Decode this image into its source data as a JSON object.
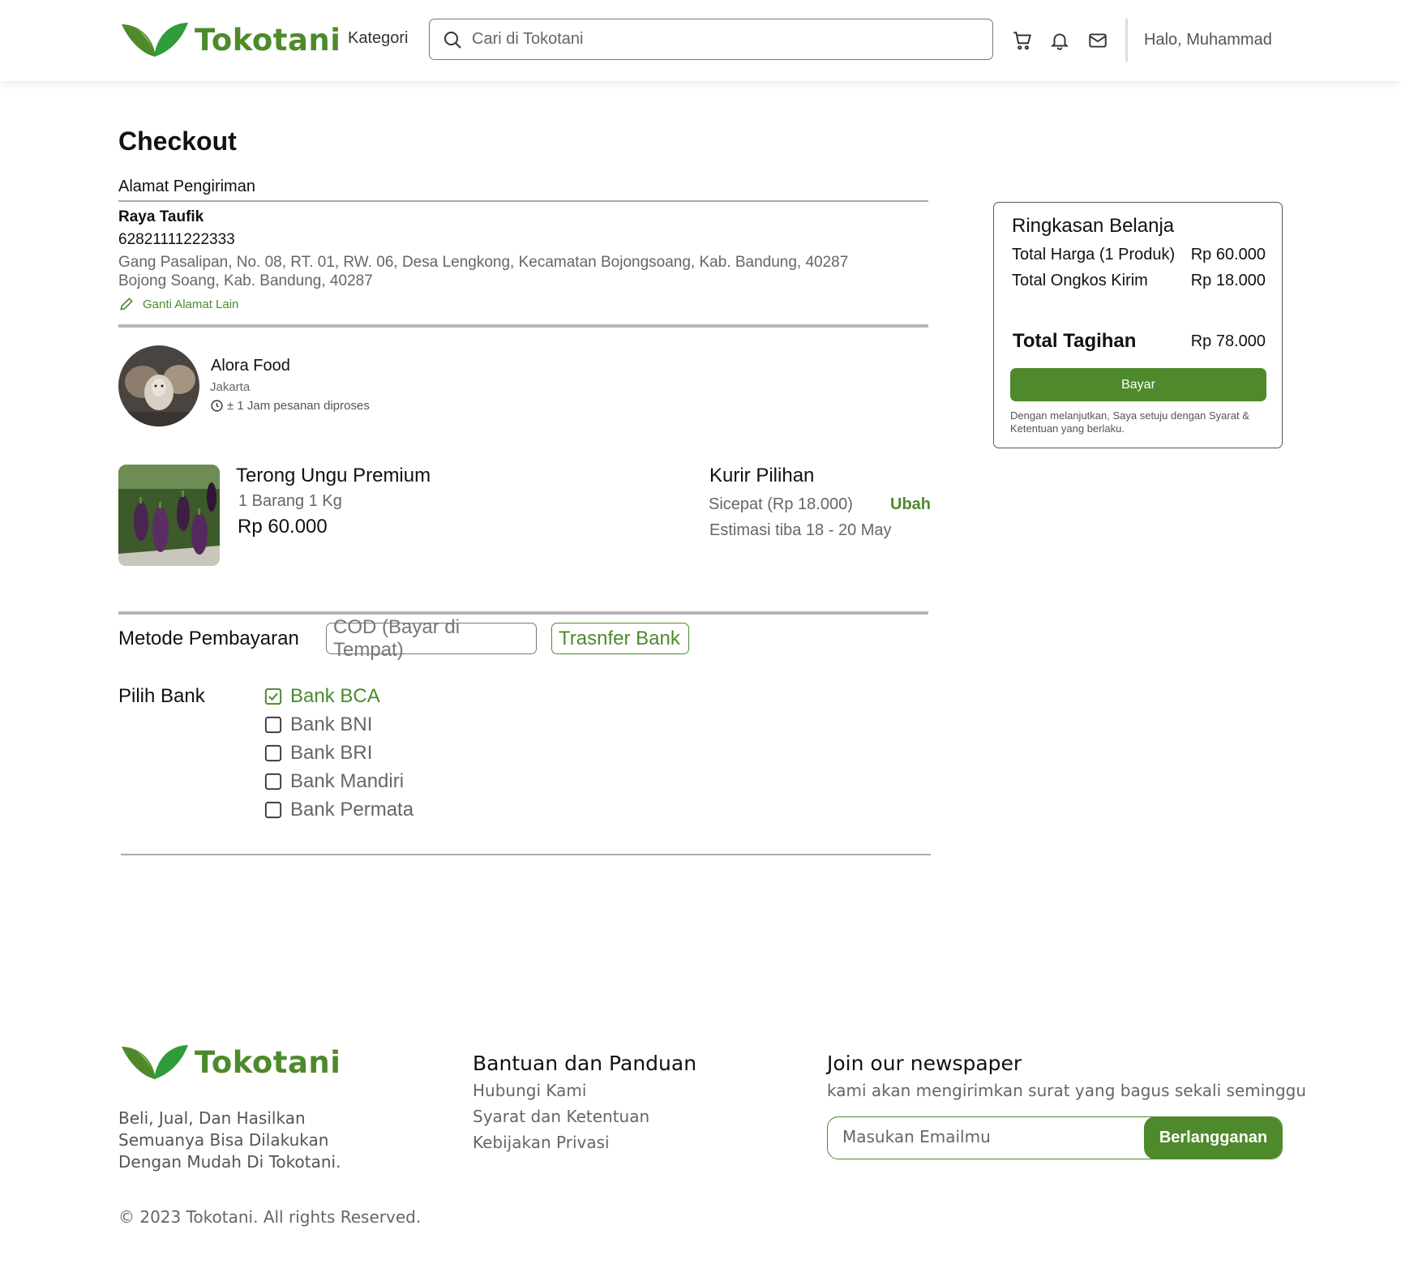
{
  "header": {
    "brand": "Tokotani",
    "kategori": "Kategori",
    "search_placeholder": "Cari di Tokotani",
    "greeting": "Halo, Muhammad"
  },
  "checkout": {
    "title": "Checkout",
    "address_section": "Alamat Pengiriman",
    "recipient_name": "Raya Taufik",
    "phone": "62821111222333",
    "address_line1": "Gang Pasalipan, No. 08, RT. 01, RW. 06, Desa Lengkong, Kecamatan Bojongsoang, Kab. Bandung, 40287",
    "address_line2": "Bojong Soang, Kab. Bandung, 40287",
    "change_address": "Ganti Alamat Lain"
  },
  "store": {
    "name": "Alora Food",
    "city": "Jakarta",
    "process_time": "± 1 Jam pesanan diproses"
  },
  "product": {
    "name": "Terong Ungu Premium",
    "qty": "1 Barang 1 Kg",
    "price": "Rp 60.000"
  },
  "courier": {
    "title": "Kurir Pilihan",
    "name": "Sicepat (Rp 18.000)",
    "change": "Ubah",
    "eta": "Estimasi tiba 18 - 20 May"
  },
  "payment": {
    "label": "Metode Pembayaran",
    "options": [
      "COD (Bayar di Tempat)",
      "Trasnfer Bank"
    ],
    "selected": "Trasnfer Bank",
    "bank_label": "Pilih Bank",
    "banks": [
      {
        "name": "Bank BCA",
        "checked": true
      },
      {
        "name": "Bank BNI",
        "checked": false
      },
      {
        "name": "Bank BRI",
        "checked": false
      },
      {
        "name": "Bank Mandiri",
        "checked": false
      },
      {
        "name": "Bank Permata",
        "checked": false
      }
    ]
  },
  "summary": {
    "title": "Ringkasan Belanja",
    "total_price_label": "Total Harga (1 Produk)",
    "total_price_value": "Rp 60.000",
    "shipping_label": "Total Ongkos Kirim",
    "shipping_value": "Rp 18.000",
    "grand_total_label": "Total Tagihan",
    "grand_total_value": "Rp 78.000",
    "pay_button": "Bayar",
    "note": "Dengan melanjutkan, Saya setuju dengan Syarat & Ketentuan yang berlaku."
  },
  "footer": {
    "brand": "Tokotani",
    "tagline": "Beli, Jual, Dan Hasilkan Semuanya Bisa Dilakukan Dengan Mudah Di Tokotani.",
    "help_title": "Bantuan dan Panduan",
    "help_links": [
      "Hubungi Kami",
      "Syarat dan Ketentuan",
      "Kebijakan Privasi"
    ],
    "newsletter_title": "Join our newspaper",
    "newsletter_sub": "kami akan mengirimkan surat yang bagus sekali seminggu",
    "email_placeholder": "Masukan Emailmu",
    "subscribe_button": "Berlangganan",
    "copyright": "© 2023 Tokotani. All rights Reserved."
  },
  "colors": {
    "brand_green": "#4e8a2c",
    "border_gray": "#777777"
  },
  "icons": [
    "leaf-logo-icon",
    "search-icon",
    "cart-icon",
    "bell-icon",
    "mail-icon",
    "pencil-icon",
    "clock-icon",
    "checkbox-checked-icon",
    "checkbox-icon"
  ]
}
